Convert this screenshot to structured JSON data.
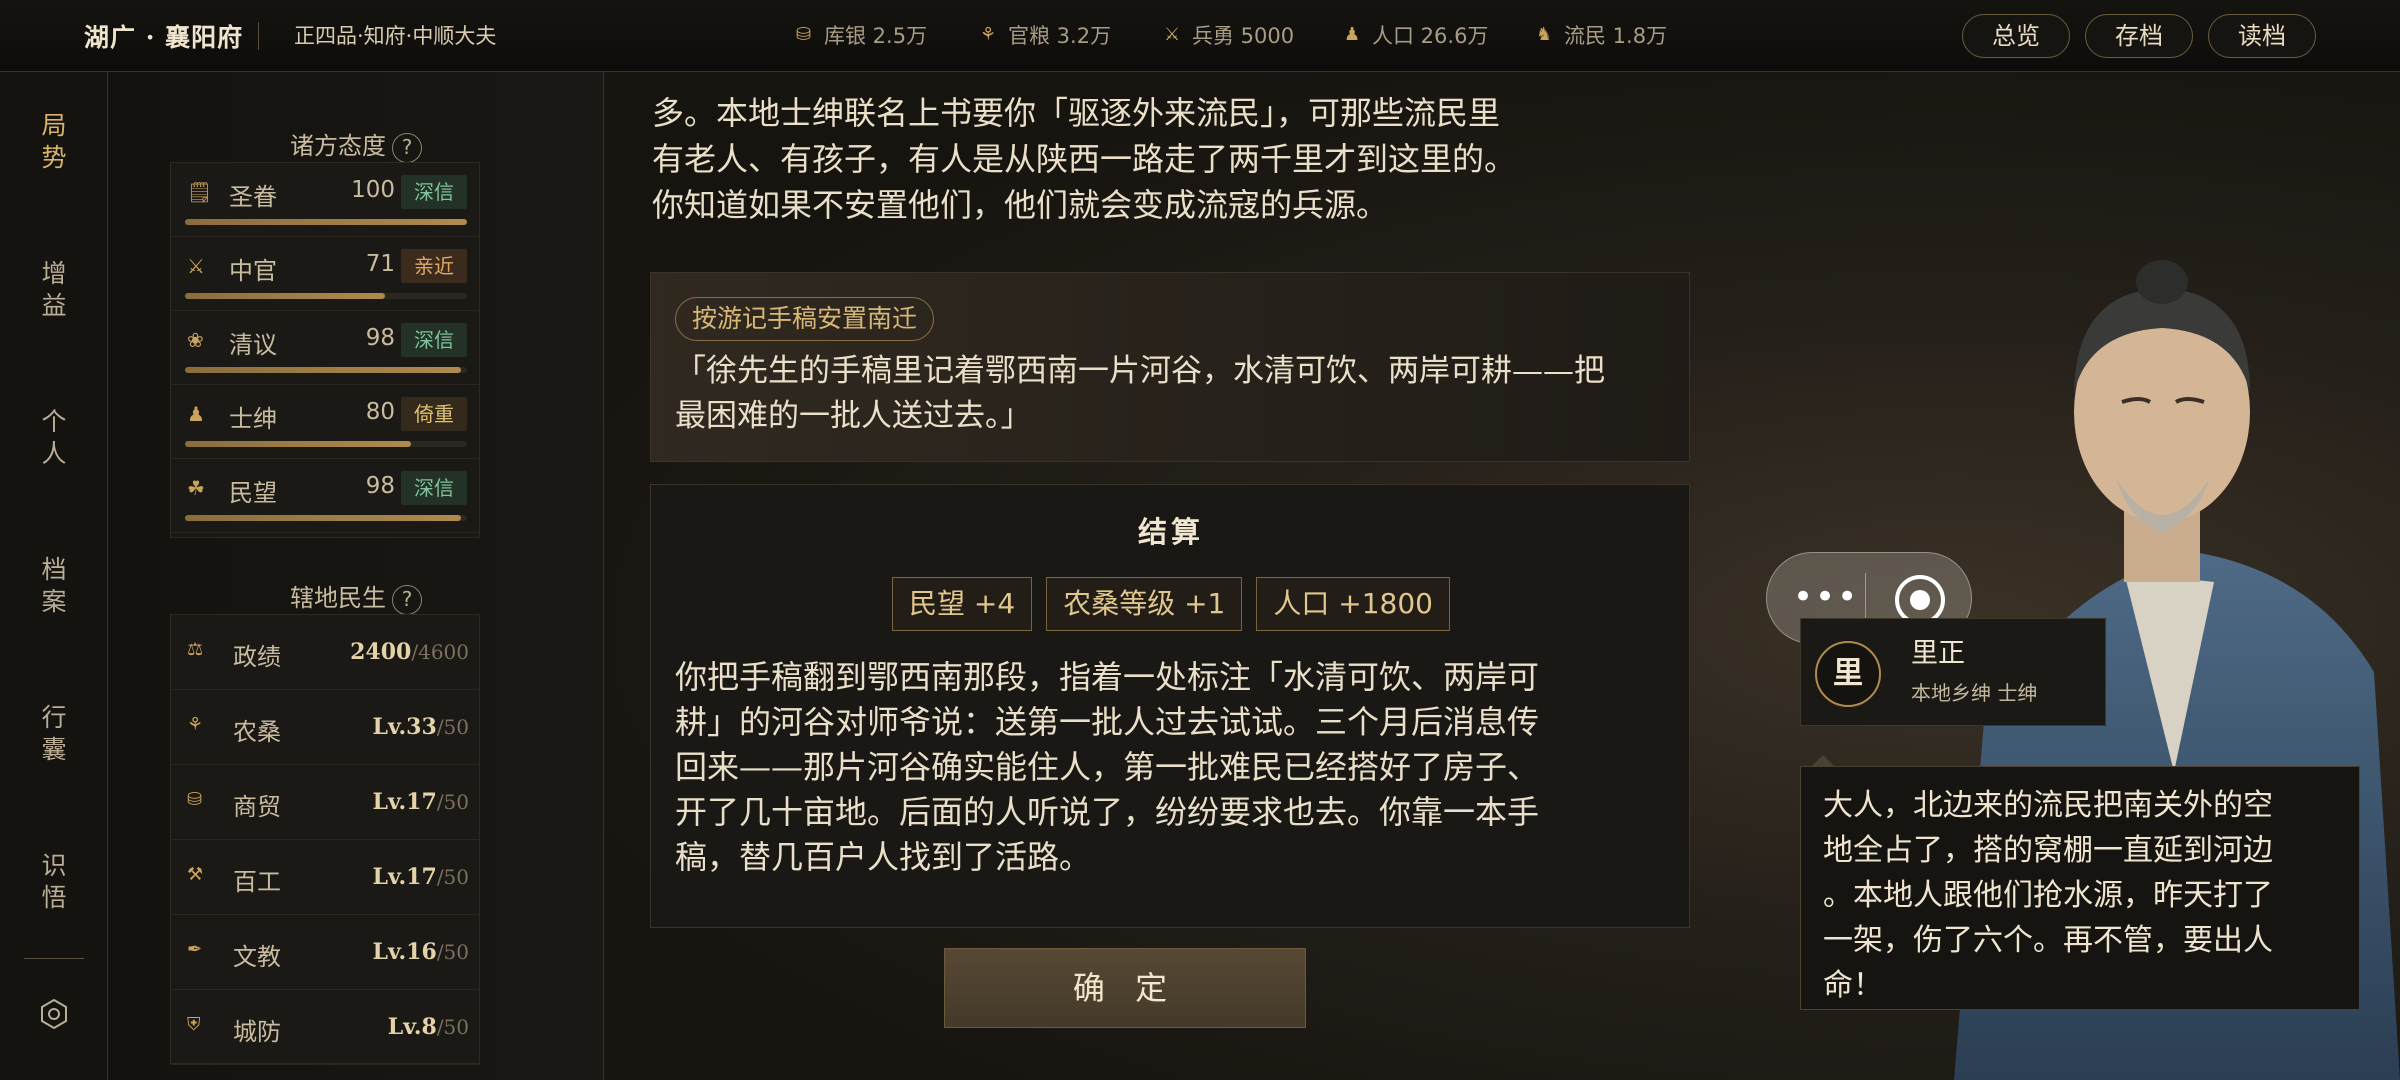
{
  "topbar": {
    "title": "湖广 · 襄阳府",
    "rank": "正四品·知府·中顺大夫",
    "resources": [
      {
        "icon": "silver-icon",
        "label": "库银 2.5万"
      },
      {
        "icon": "grain-icon",
        "label": "官粮 3.2万"
      },
      {
        "icon": "soldier-icon",
        "label": "兵勇 5000"
      },
      {
        "icon": "population-icon",
        "label": "人口 26.6万"
      },
      {
        "icon": "refugee-icon",
        "label": "流民 1.8万"
      }
    ],
    "buttons": {
      "overview": "总览",
      "save": "存档",
      "load": "读档"
    }
  },
  "nav": {
    "items": [
      {
        "label": "局势",
        "active": true
      },
      {
        "label": "增益"
      },
      {
        "label": "个人"
      },
      {
        "label": "档案"
      },
      {
        "label": "行囊"
      },
      {
        "label": "识悟"
      }
    ],
    "settings_icon": "gear-icon"
  },
  "attitudes": {
    "heading": "诸方态度",
    "help": "?",
    "rows": [
      {
        "icon": "imperial-icon",
        "name": "圣眷",
        "value": "100",
        "tag": "深信",
        "tag_style": "deep",
        "level": 1.0
      },
      {
        "icon": "officials-icon",
        "name": "中官",
        "value": "71",
        "tag": "亲近",
        "tag_style": "close",
        "level": 0.71
      },
      {
        "icon": "scholars-icon",
        "name": "清议",
        "value": "98",
        "tag": "深信",
        "tag_style": "deep",
        "level": 0.98
      },
      {
        "icon": "gentry-icon",
        "name": "士绅",
        "value": "80",
        "tag": "倚重",
        "tag_style": "rely",
        "level": 0.8
      },
      {
        "icon": "people-icon",
        "name": "民望",
        "value": "98",
        "tag": "深信",
        "tag_style": "deep",
        "level": 0.98
      }
    ]
  },
  "livelihood": {
    "heading": "辖地民生",
    "help": "?",
    "rows": [
      {
        "icon": "merit-icon",
        "name": "政绩",
        "value": "2400",
        "max": "/4600"
      },
      {
        "icon": "farm-icon",
        "name": "农桑",
        "value": "Lv.33",
        "max": "/50"
      },
      {
        "icon": "trade-icon",
        "name": "商贸",
        "value": "Lv.17",
        "max": "/50"
      },
      {
        "icon": "craft-icon",
        "name": "百工",
        "value": "Lv.17",
        "max": "/50"
      },
      {
        "icon": "education-icon",
        "name": "文教",
        "value": "Lv.16",
        "max": "/50"
      },
      {
        "icon": "defense-icon",
        "name": "城防",
        "value": "Lv.8",
        "max": "/50"
      }
    ]
  },
  "story": {
    "lines": [
      "多。本地士绅联名上书要你「驱逐外来流民」，可那些流民里",
      "有老人、有孩子，有人是从陕西一路走了两千里才到这里的。",
      "你知道如果不安置他们，他们就会变成流寇的兵源。"
    ]
  },
  "choice": {
    "tag": "按游记手稿安置南迁",
    "quote_lines": [
      "「徐先生的手稿里记着鄂西南一片河谷，水清可饮、两岸可耕——把",
      "最困难的一批人送过去。」"
    ]
  },
  "settlement": {
    "title": "结算",
    "chips": [
      "民望 +4",
      "农桑等级 +1",
      "人口 +1800"
    ],
    "lines": [
      "你把手稿翻到鄂西南那段，指着一处标注「水清可饮、两岸可",
      "耕」的河谷对师爷说：送第一批人过去试试。三个月后消息传",
      "回来——那片河谷确实能住人，第一批难民已经搭好了房子、",
      "开了几十亩地。后面的人听说了，纷纷要求也去。你靠一本手",
      "稿，替几百户人找到了活路。"
    ],
    "confirm": "确 定"
  },
  "npc": {
    "badge": "里",
    "name": "里正",
    "title": "本地乡绅 士绅",
    "speech_lines": [
      "大人，北边来的流民把南关外的空",
      "地全占了，搭的窝棚一直延到河边",
      "。本地人跟他们抢水源，昨天打了",
      "一架，伤了六个。再不管，要出人",
      "命！"
    ]
  },
  "floating": {
    "more_icon": "more-dots-icon",
    "target_icon": "record-target-icon"
  }
}
